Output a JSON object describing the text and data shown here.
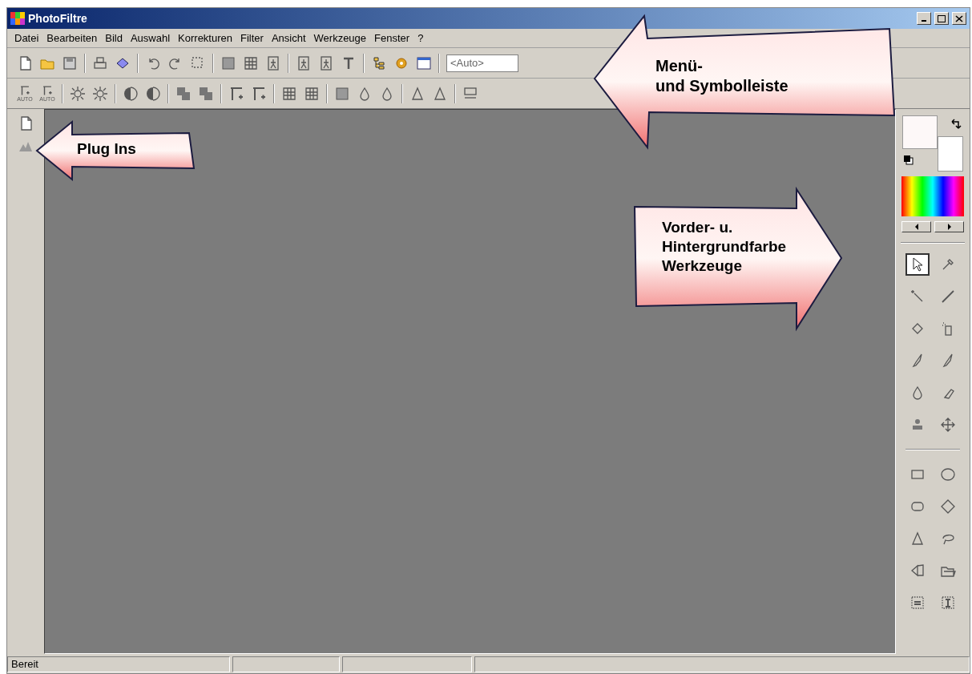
{
  "window": {
    "title": "PhotoFiltre"
  },
  "menu": [
    "Datei",
    "Bearbeiten",
    "Bild",
    "Auswahl",
    "Korrekturen",
    "Filter",
    "Ansicht",
    "Werkzeuge",
    "Fenster",
    "?"
  ],
  "toolbar": {
    "zoom_field": {
      "value": "<Auto>"
    },
    "auto_labels": [
      "AUTO",
      "AUTO"
    ]
  },
  "toolbox": {
    "tools": [
      {
        "selected": true
      },
      {
        "selected": false
      },
      {
        "selected": false
      },
      {
        "selected": false
      },
      {
        "selected": false
      },
      {
        "selected": false
      },
      {
        "selected": false
      },
      {
        "selected": false
      },
      {
        "selected": false
      },
      {
        "selected": false
      },
      {
        "selected": false
      },
      {
        "selected": false
      },
      {
        "selected": false
      },
      {
        "selected": false
      },
      {
        "selected": false
      },
      {
        "selected": false
      },
      {
        "selected": false
      },
      {
        "selected": false
      },
      {
        "selected": false
      },
      {
        "selected": false
      }
    ]
  },
  "annotations": [
    {
      "kind": "left",
      "lines": [
        "Menü-",
        "und Symbolleiste"
      ]
    },
    {
      "kind": "left-small",
      "lines": [
        "Plug Ins"
      ]
    },
    {
      "kind": "right",
      "lines": [
        "Vorder- u.",
        "Hintergrundfarbe",
        "Werkzeuge"
      ]
    }
  ],
  "status_bar": {
    "text": "Bereit"
  }
}
